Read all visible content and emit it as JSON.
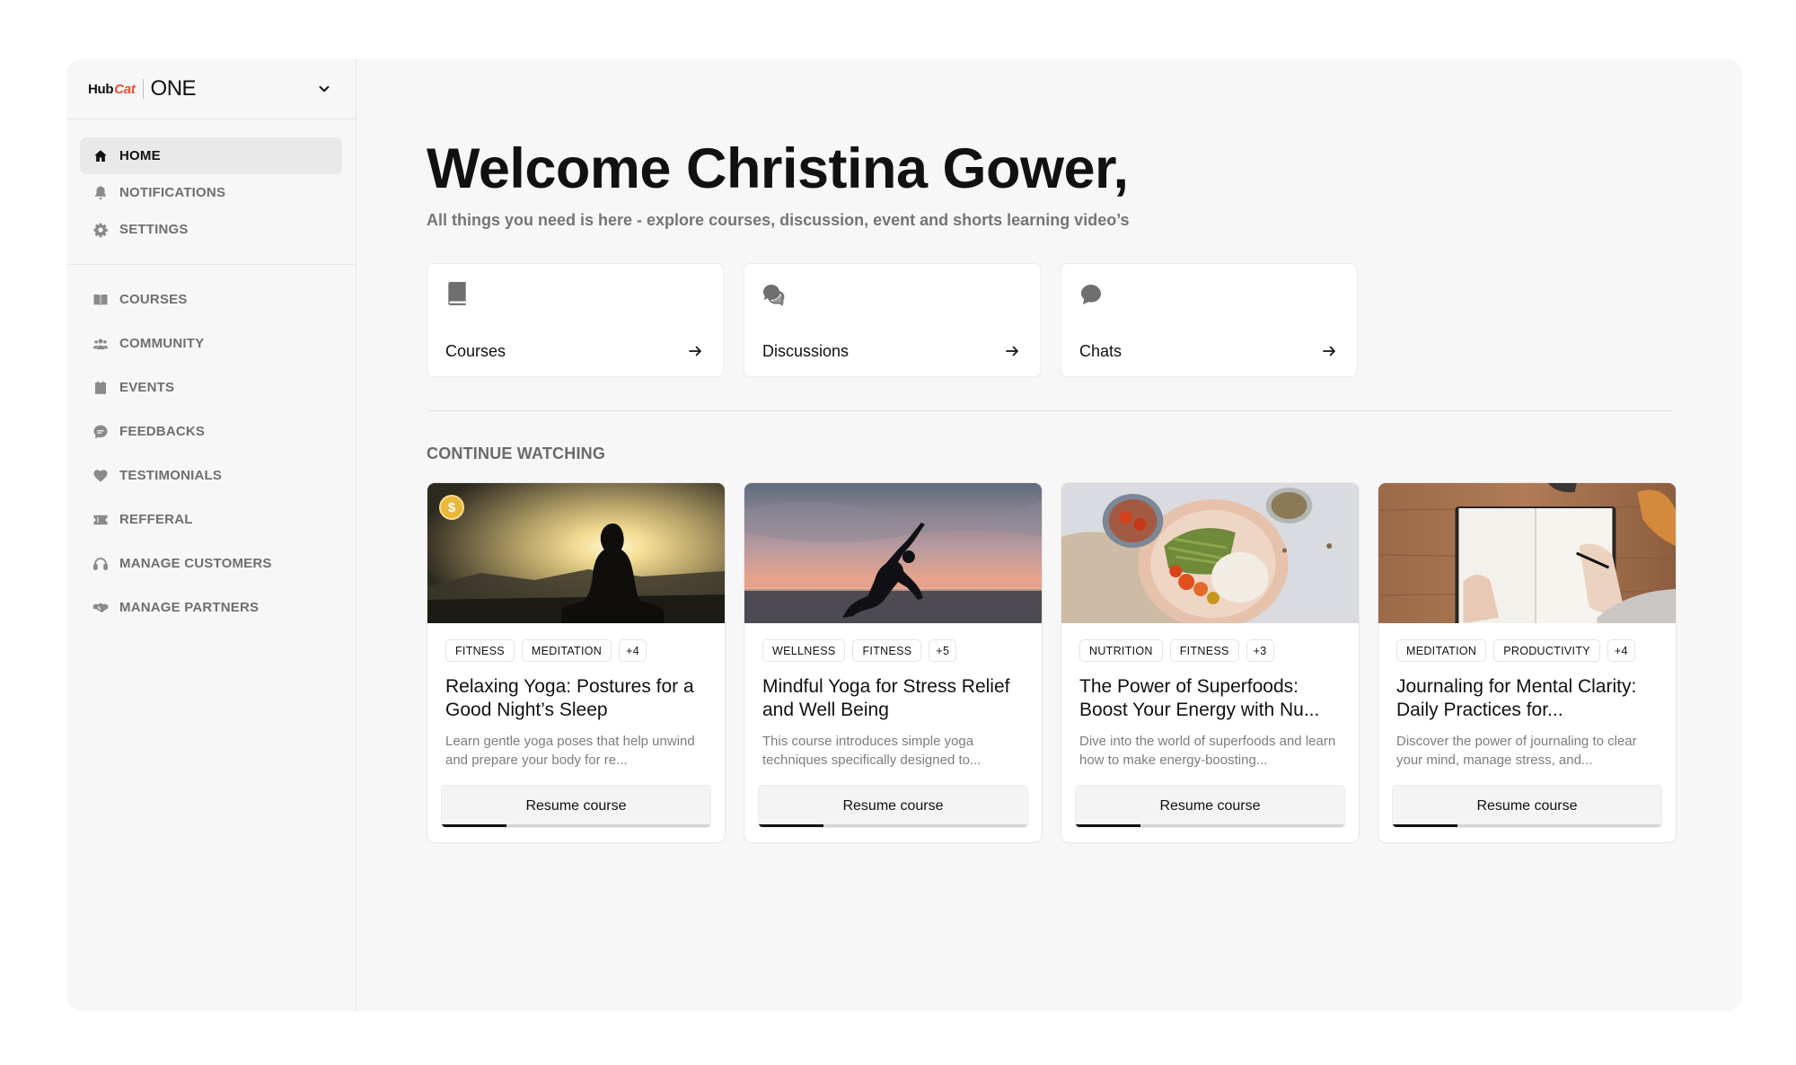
{
  "brand": {
    "hub": "Hub",
    "cat": "Cat",
    "product": "ONE"
  },
  "nav": {
    "primary": [
      {
        "label": "HOME",
        "icon": "home-icon",
        "active": true
      },
      {
        "label": "NOTIFICATIONS",
        "icon": "bell-icon",
        "active": false
      },
      {
        "label": "SETTINGS",
        "icon": "gear-icon",
        "active": false
      }
    ],
    "secondary": [
      {
        "label": "COURSES",
        "icon": "book-open-icon"
      },
      {
        "label": "COMMUNITY",
        "icon": "users-icon"
      },
      {
        "label": "EVENTS",
        "icon": "calendar-icon"
      },
      {
        "label": "FEEDBACKS",
        "icon": "chat-bubble-icon"
      },
      {
        "label": "TESTIMONIALS",
        "icon": "heart-icon"
      },
      {
        "label": "REFFERAL",
        "icon": "ticket-icon"
      },
      {
        "label": "MANAGE CUSTOMERS",
        "icon": "headset-icon"
      },
      {
        "label": "MANAGE PARTNERS",
        "icon": "handshake-icon"
      }
    ]
  },
  "header": {
    "welcome": "Welcome Christina Gower,",
    "subtitle": "All things you need is here - explore courses, discussion, event and shorts learning video’s"
  },
  "quick_links": [
    {
      "label": "Courses",
      "icon": "book-icon"
    },
    {
      "label": "Discussions",
      "icon": "discussions-icon"
    },
    {
      "label": "Chats",
      "icon": "chat-icon"
    }
  ],
  "continue_watching": {
    "title": "CONTINUE WATCHING",
    "button_label": "Resume course",
    "courses": [
      {
        "tags": [
          "FITNESS",
          "MEDITATION",
          "+4"
        ],
        "title": "Relaxing Yoga: Postures for a Good Night’s Sleep",
        "description": "Learn gentle yoga poses that help unwind and prepare your body for re...",
        "progress": 0.24,
        "paid_badge": "$",
        "image": "meditation-silhouette-sunset"
      },
      {
        "tags": [
          "WELLNESS",
          "FITNESS",
          "+5"
        ],
        "title": "Mindful Yoga for Stress Relief and Well Being",
        "description": "This course introduces simple yoga techniques specifically designed to...",
        "progress": 0.24,
        "image": "yoga-pose-beach-sunset"
      },
      {
        "tags": [
          "NUTRITION",
          "FITNESS",
          "+3"
        ],
        "title": "The Power of Superfoods: Boost Your Energy with Nu...",
        "description": "Dive into the world of superfoods and learn how to make energy-boosting...",
        "progress": 0.24,
        "image": "superfood-bowl"
      },
      {
        "tags": [
          "MEDITATION",
          "PRODUCTIVITY",
          "+4"
        ],
        "title": "Journaling for Mental Clarity: Daily Practices for...",
        "description": "Discover the power of journaling to clear your mind, manage stress, and...",
        "progress": 0.24,
        "image": "journal-writing-desk"
      }
    ]
  }
}
